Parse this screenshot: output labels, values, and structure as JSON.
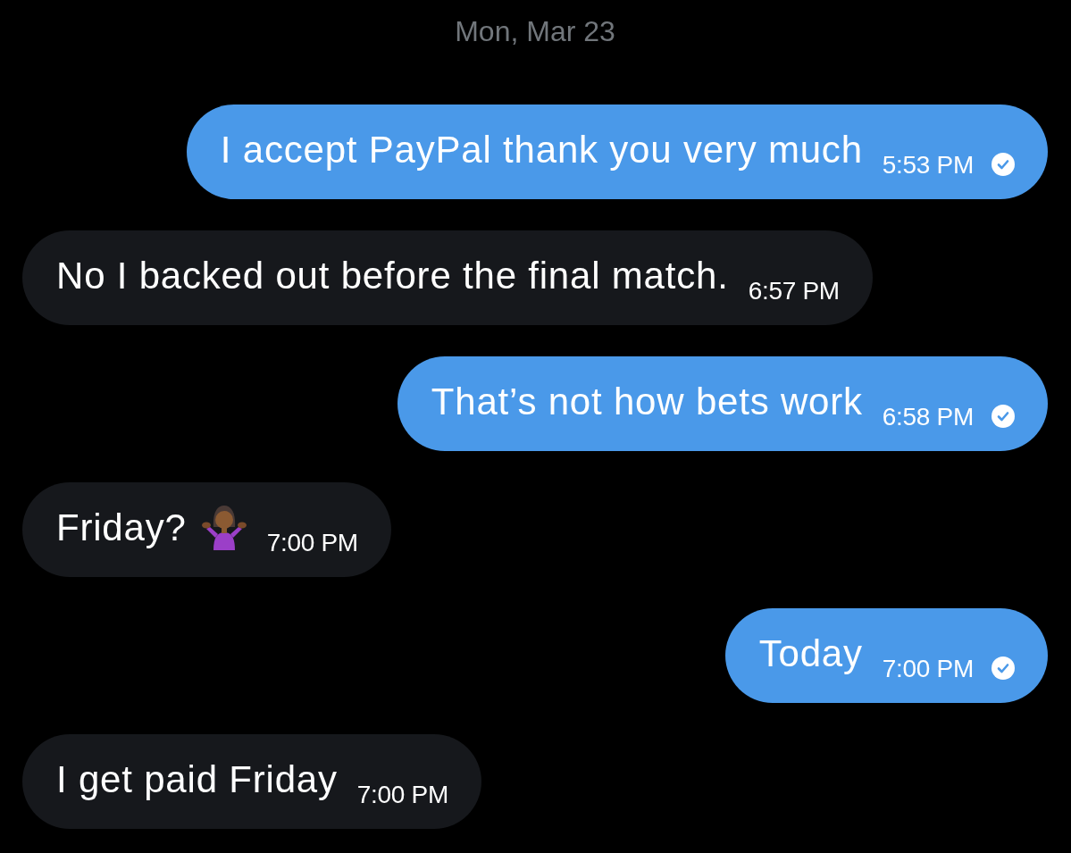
{
  "date_header": "Mon, Mar 23",
  "messages": [
    {
      "kind": "sent",
      "text": "I accept PayPal thank you very much",
      "time": "5:53 PM",
      "trailing_emoji": false
    },
    {
      "kind": "received",
      "text": "No I backed out before the final match.",
      "time": "6:57 PM",
      "trailing_emoji": false
    },
    {
      "kind": "sent",
      "text": "That’s not how bets work",
      "time": "6:58 PM",
      "trailing_emoji": false
    },
    {
      "kind": "received",
      "text": "Friday?",
      "time": "7:00 PM",
      "trailing_emoji": true
    },
    {
      "kind": "sent",
      "text": "Today",
      "time": "7:00 PM",
      "trailing_emoji": false
    },
    {
      "kind": "received",
      "text": "I get paid Friday",
      "time": "7:00 PM",
      "trailing_emoji": false
    }
  ]
}
